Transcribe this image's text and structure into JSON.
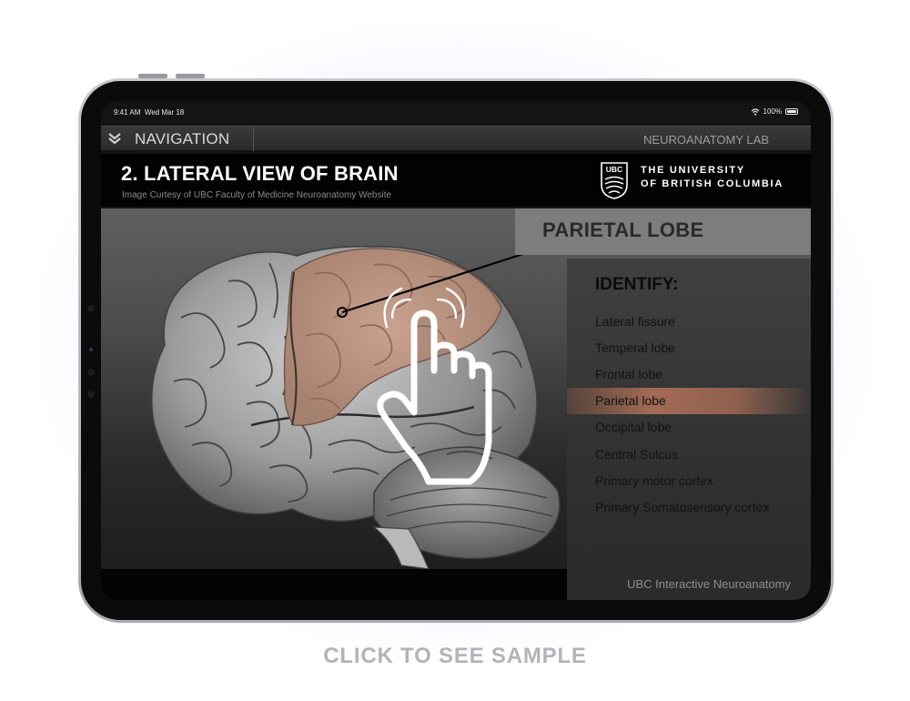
{
  "status_bar": {
    "time": "9:41 AM",
    "date": "Wed Mar 18",
    "battery": "100%"
  },
  "nav": {
    "navigation_label": "NAVIGATION",
    "lab_label": "NEUROANATOMY LAB"
  },
  "header": {
    "title": "2. LATERAL VIEW OF BRAIN",
    "credit": "Image Curtesy of UBC Faculty of Medicine Neuroanatomy Website",
    "logo_text": "UBC",
    "university_line1": "THE UNIVERSITY",
    "university_line2": "OF BRITISH COLUMBIA"
  },
  "main": {
    "selected_region": "PARIETAL LOBE",
    "identify_title": "IDENTIFY:",
    "items": [
      {
        "label": "Lateral fissure"
      },
      {
        "label": "Temperal lobe"
      },
      {
        "label": "Frontal lobe"
      },
      {
        "label": "Parietal lobe",
        "active": true
      },
      {
        "label": "Occipital lobe"
      },
      {
        "label": "Central Sulcus"
      },
      {
        "label": "Primary motor cortex"
      },
      {
        "label": "Primary Somatosensory cortex"
      }
    ]
  },
  "footer": {
    "label": "UBC Interactive Neuroanatomy"
  },
  "cta": {
    "label": "CLICK TO SEE SAMPLE"
  },
  "colors": {
    "highlight": "#c8917a",
    "panel": "#7d7d7d",
    "background": "#ffffff"
  }
}
